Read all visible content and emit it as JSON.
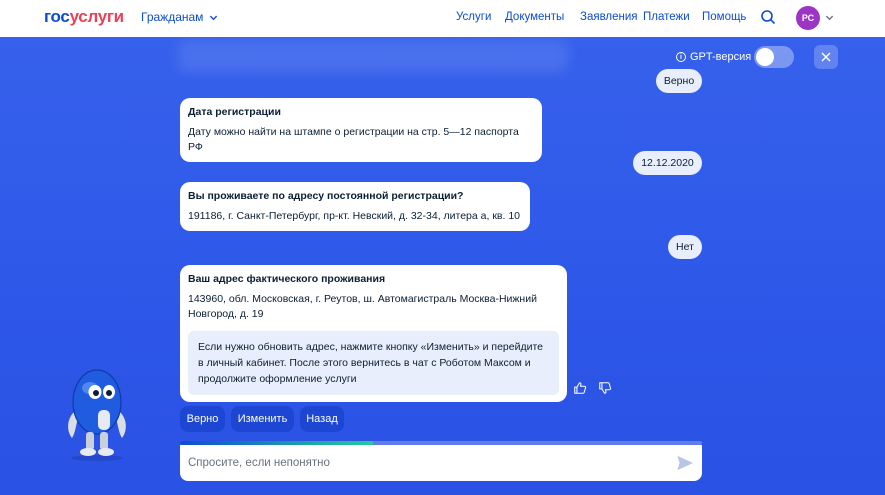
{
  "header": {
    "logo_part1": "гос",
    "logo_part2": "услуги",
    "audience": "Гражданам",
    "nav": [
      "Услуги",
      "Документы",
      "Заявления",
      "Платежи",
      "Помощь"
    ],
    "avatar_initials": "РС"
  },
  "chat": {
    "gpt_label": "GPT-версия",
    "gpt_enabled": false,
    "messages": {
      "user_1": "Верно",
      "bot_1_question": "Дата регистрации",
      "bot_1_answer": "Дату можно найти на штампе о регистрации на стр. 5—12 паспорта РФ",
      "user_2": "12.12.2020",
      "bot_2_question": "Вы проживаете по адресу постоянной регистрации?",
      "bot_2_answer": "191186, г. Санкт-Петербург, пр-кт. Невский, д. 32-34, литера а, кв. 10",
      "user_3": "Нет",
      "bot_3_question": "Ваш адрес фактического проживания",
      "bot_3_answer": "143960, обл. Московская, г. Реутов, ш. Автомагистраль Москва-Нижний Новгород, д. 19",
      "bot_3_hint": "Если нужно обновить адрес, нажмите кнопку «Изменить» и перейдите в личный кабинет. После этого вернитесь в чат с Роботом Максом и продолжите оформление услуги"
    },
    "quick_replies": [
      "Верно",
      "Изменить",
      "Назад"
    ],
    "progress": 0.37,
    "input_placeholder": "Спросите, если непонятно",
    "input_value": ""
  },
  "colors": {
    "brand_blue": "#0d4cd3",
    "brand_red": "#ee3f58",
    "chat_background": "#2f5bea",
    "avatar": "#9c35c6",
    "quick_reply": "#1d47d3"
  },
  "icons": [
    "chevron-down-icon",
    "search-icon",
    "info-icon",
    "close-icon",
    "thumbs-up-icon",
    "thumbs-down-icon",
    "send-icon",
    "robot-max-mascot"
  ]
}
